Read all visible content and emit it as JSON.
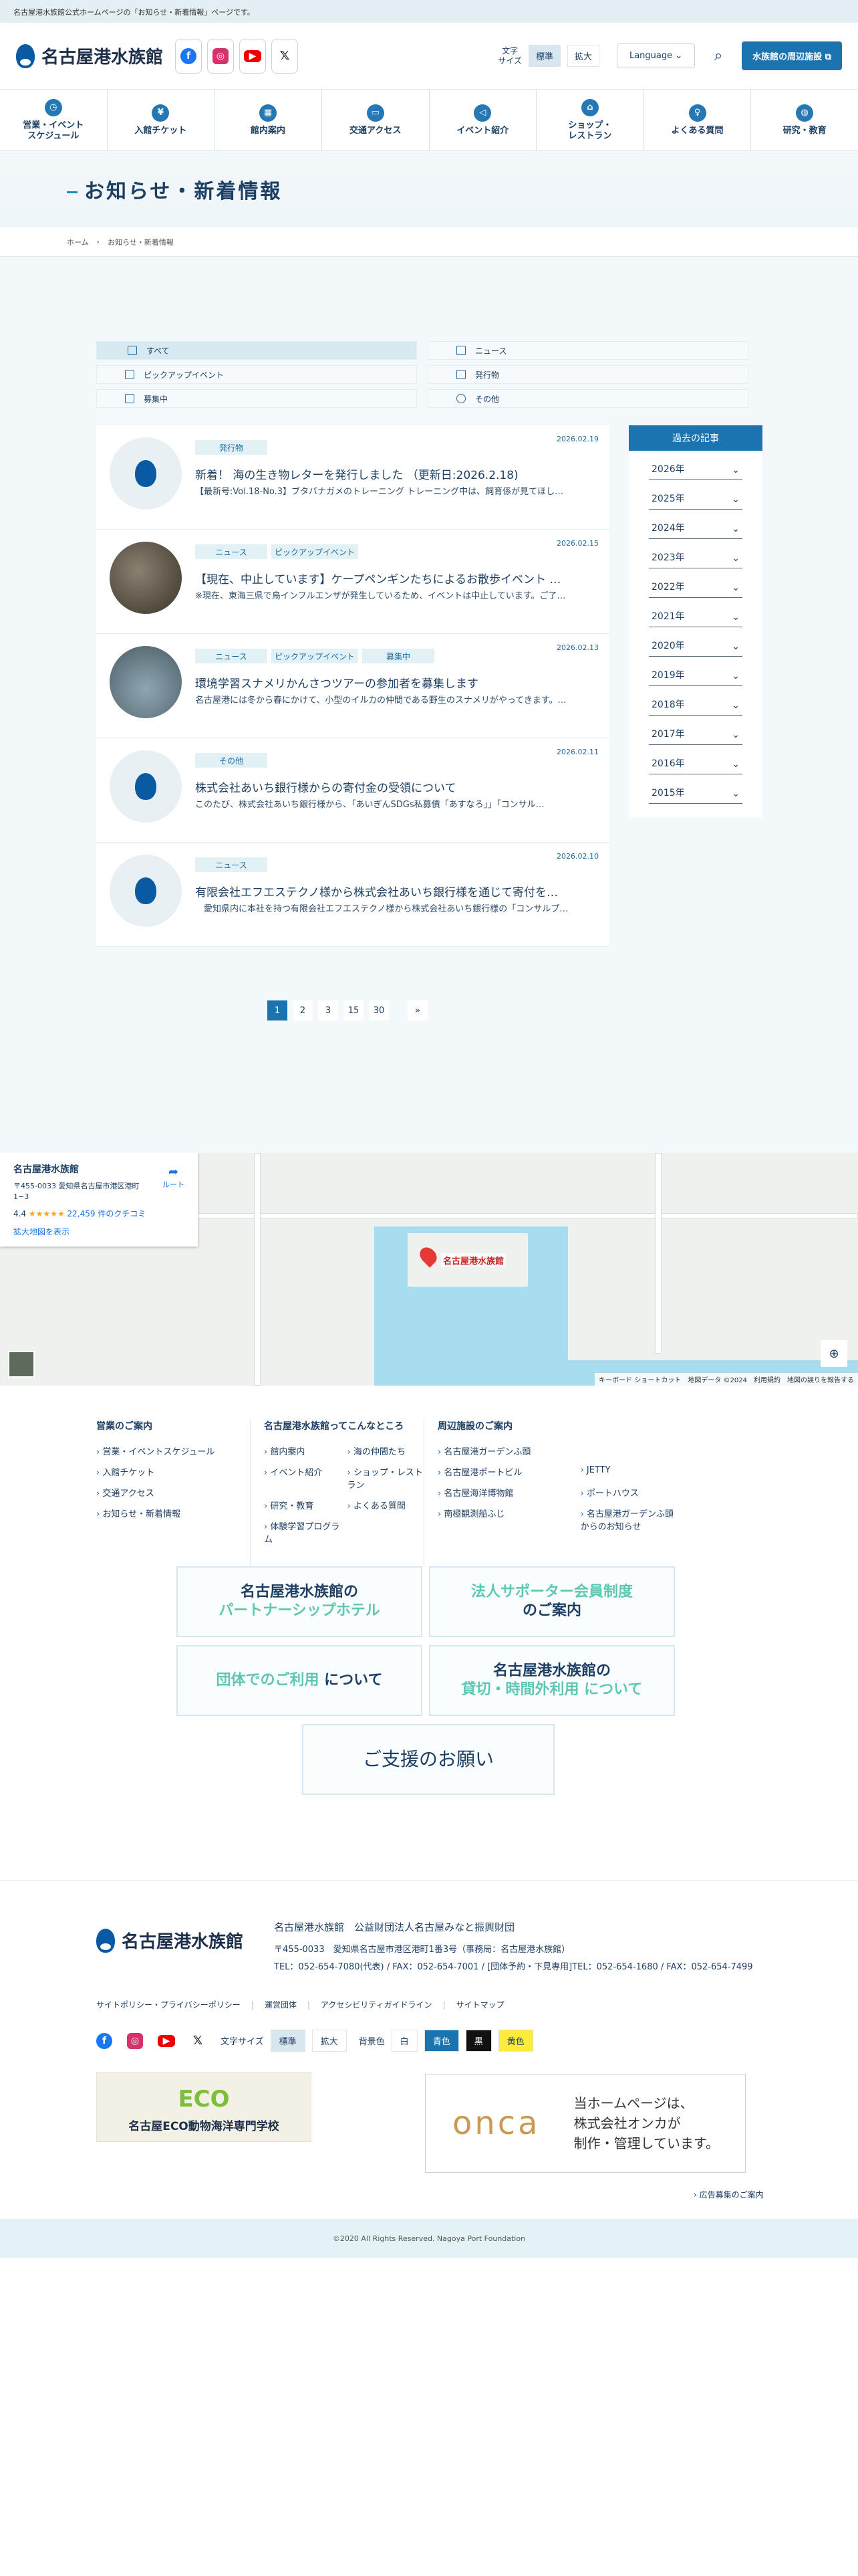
{
  "top_strip": "名古屋港水族館公式ホームページの「お知らせ・新着情報」ページです。",
  "header": {
    "logo_text": "名古屋港水族館",
    "font_size_label": "文字\nサイズ",
    "font_size_options": [
      "標準",
      "拡大"
    ],
    "language": "Language",
    "nearby_button": "水族館の周辺施設"
  },
  "nav": [
    {
      "label": "営業・イベント\nスケジュール",
      "icon": "clock-icon"
    },
    {
      "label": "入館チケット",
      "icon": "yen-icon"
    },
    {
      "label": "館内案内",
      "icon": "map-icon"
    },
    {
      "label": "交通アクセス",
      "icon": "bus-icon"
    },
    {
      "label": "イベント紹介",
      "icon": "megaphone-icon"
    },
    {
      "label": "ショップ・\nレストラン",
      "icon": "shop-icon"
    },
    {
      "label": "よくある質問",
      "icon": "bulb-icon"
    },
    {
      "label": "研究・教育",
      "icon": "globe-icon"
    }
  ],
  "page_title": "お知らせ・新着情報",
  "breadcrumb": [
    "ホーム",
    "お知らせ・新着情報"
  ],
  "categories": [
    "すべて",
    "ニュース",
    "ピックアップイベント",
    "発行物",
    "募集中",
    "その他"
  ],
  "news": [
    {
      "date": "2026.02.19",
      "tags": [
        "発行物"
      ],
      "title": "新着！ 海の生き物レターを発行しました （更新日:2026.2.18)",
      "excerpt": "【最新号:Vol.18-No.3】ブタバナガメのトレーニング トレーニング中は、飼育係が見てほし…",
      "thumb": "logo"
    },
    {
      "date": "2026.02.15",
      "tags": [
        "ニュース",
        "ピックアップイベント"
      ],
      "title": "【現在、中止しています】ケープペンギンたちによるお散歩イベント …",
      "excerpt": "※現在、東海三県で鳥インフルエンザが発生しているため、イベントは中止しています。ご了…",
      "thumb": "peng"
    },
    {
      "date": "2026.02.13",
      "tags": [
        "ニュース",
        "ピックアップイベント",
        "募集中"
      ],
      "title": "環境学習スナメリかんさつツアーの参加者を募集します",
      "excerpt": "名古屋港には冬から春にかけて、小型のイルカの仲間である野生のスナメリがやってきます。…",
      "thumb": "dol"
    },
    {
      "date": "2026.02.11",
      "tags": [
        "その他"
      ],
      "title": "株式会社あいち銀行様からの寄付金の受領について",
      "excerpt": "このたび、株式会社あいち銀行様から、「あいぎんSDGs私募債「あすなろ」」「コンサル…",
      "thumb": "logo"
    },
    {
      "date": "2026.02.10",
      "tags": [
        "ニュース"
      ],
      "title": "有限会社エフエステクノ様から株式会社あいち銀行様を通じて寄付を…",
      "excerpt": "　愛知県内に本社を持つ有限会社エフエステクノ様から株式会社あいち銀行様の「コンサルプ…",
      "thumb": "logo"
    }
  ],
  "archive": {
    "heading": "過去の記事",
    "years": [
      "2026年",
      "2025年",
      "2024年",
      "2023年",
      "2022年",
      "2021年",
      "2020年",
      "2019年",
      "2018年",
      "2017年",
      "2016年",
      "2015年"
    ]
  },
  "pagination": [
    "1",
    "2",
    "3",
    "15",
    "30",
    "»"
  ],
  "map": {
    "place": "名古屋港水族館",
    "address": "〒455-0033 愛知県名古屋市港区港町\n1−3",
    "rating": "4.4",
    "stars": "★★★★★",
    "reviews": "22,459 件のクチコミ",
    "enlarge": "拡大地図を表示",
    "route": "ルート",
    "pin_label": "名古屋港水族館",
    "legal": "キーボード ショートカット　地図データ ©2024　利用規約　地図の誤りを報告する"
  },
  "footer_nav": [
    {
      "heading": "営業のご案内",
      "items": [
        "営業・イベントスケジュール",
        "入館チケット",
        "交通アクセス",
        "お知らせ・新着情報"
      ]
    },
    {
      "heading": "名古屋港水族館ってこんなところ",
      "items": [
        "館内案内",
        "海の仲間たち",
        "イベント紹介",
        "ショップ・レストラン",
        "研究・教育",
        "よくある質問",
        "体験学習プログラム"
      ]
    },
    {
      "heading": "周辺施設のご案内",
      "items": [
        "名古屋港ガーデンふ頭",
        "名古屋港ポートビル",
        "JETTY",
        "名古屋海洋博物館",
        "ポートハウス",
        "南極観測船ふじ",
        "名古屋港ガーデンふ頭からのお知らせ"
      ]
    }
  ],
  "banners": [
    {
      "line1": "名古屋港水族館の",
      "line2": "パートナーシップホテル"
    },
    {
      "line1": "法人サポーター会員制度",
      "line2": "のご案内"
    },
    {
      "line1": "団体でのご利用",
      "line2": "について"
    },
    {
      "line1": "名古屋港水族館の",
      "line2": "貸切・時間外利用 について"
    },
    {
      "line1": "ご支援のお願い",
      "line2": ""
    }
  ],
  "footer": {
    "org": "名古屋港水族館　公益財団法人名古屋みなと振興財団",
    "address": "〒455-0033　愛知県名古屋市港区港町1番3号（事務局：名古屋港水族館）",
    "tel": "TEL：052-654-7080(代表) / FAX：052-654-7001 / [団体予約・下見専用]TEL：052-654-1680 / FAX：052-654-7499",
    "links": [
      "サイトポリシー・プライバシーポリシー",
      "運営団体",
      "アクセシビリティガイドライン",
      "サイトマップ"
    ],
    "font_size_label": "文字サイズ",
    "font_size_options": [
      "標準",
      "拡大"
    ],
    "bg_label": "背景色",
    "bg_options": [
      "白",
      "青色",
      "黒",
      "黄色"
    ],
    "ad1_eco": "ECO",
    "ad1_title": "名古屋ECO動物海洋専門学校",
    "ad2_logo": "onca",
    "ad2_text": "当ホームページは、\n株式会社オンカが\n制作・管理しています。",
    "ad_note": "› 広告募集のご案内",
    "copyright": "©2020 All Rights Reserved. Nagoya Port Foundation"
  }
}
